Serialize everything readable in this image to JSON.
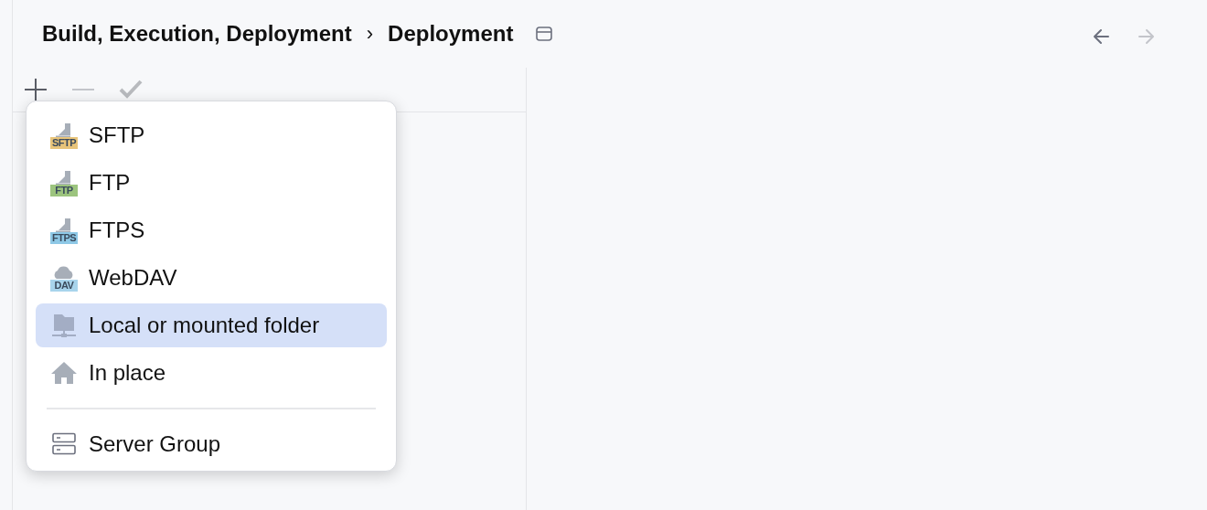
{
  "breadcrumb": [
    {
      "label": "Build, Execution, Deployment"
    },
    {
      "label": "Deployment"
    }
  ],
  "breadcrumb_separator": "›",
  "navigation": {
    "back": {
      "disabled": false
    },
    "forward": {
      "disabled": true
    }
  },
  "toolbar": [
    {
      "kind": "add",
      "disabled": false
    },
    {
      "kind": "remove",
      "disabled": true
    },
    {
      "kind": "apply",
      "disabled": true
    }
  ],
  "menu": {
    "items": [
      {
        "kind": "badge",
        "label": "SFTP",
        "badge": "SFTP",
        "color": "#e8c47a",
        "selected": false
      },
      {
        "kind": "badge",
        "label": "FTP",
        "badge": "FTP",
        "color": "#9cc47e",
        "selected": false
      },
      {
        "kind": "badge",
        "label": "FTPS",
        "badge": "FTPS",
        "color": "#8ec8e6",
        "selected": false
      },
      {
        "kind": "cloud",
        "label": "WebDAV",
        "badge": "DAV",
        "color": "#a8d4ec",
        "selected": false
      },
      {
        "kind": "folder",
        "label": "Local or mounted folder",
        "selected": true
      },
      {
        "kind": "home",
        "label": "In place",
        "selected": false
      },
      {
        "kind": "separator"
      },
      {
        "kind": "servers",
        "label": "Server Group",
        "selected": false
      }
    ]
  }
}
